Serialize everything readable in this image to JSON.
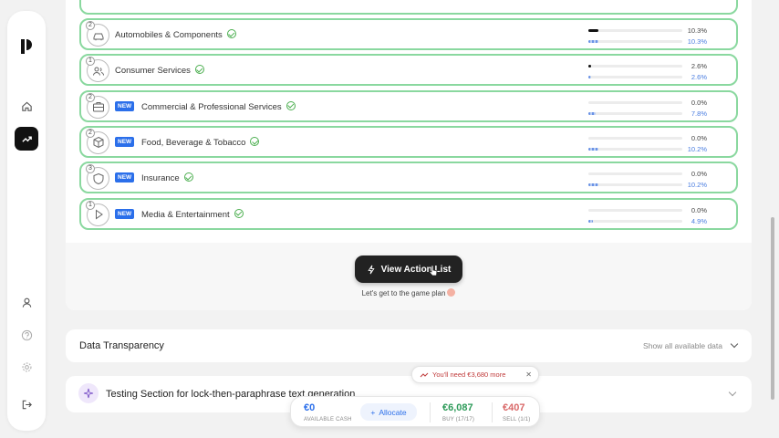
{
  "sidebar": {
    "items": [
      {
        "name": "home",
        "icon": "home-icon"
      },
      {
        "name": "trending",
        "icon": "trending-up-icon",
        "active": true
      },
      {
        "name": "profile",
        "icon": "user-icon"
      },
      {
        "name": "help",
        "icon": "help-icon"
      },
      {
        "name": "settings",
        "icon": "gear-icon"
      },
      {
        "name": "logout",
        "icon": "logout-icon"
      }
    ]
  },
  "sectors": [
    {
      "step": "2",
      "name": "Automobiles & Components",
      "is_new": false,
      "badge": "",
      "current": "10.3%",
      "target": "10.3%",
      "current_value": 0.103,
      "target_value": 0.103,
      "icon": "car-icon"
    },
    {
      "step": "1",
      "name": "Consumer Services",
      "is_new": false,
      "badge": "",
      "current": "2.6%",
      "target": "2.6%",
      "current_value": 0.026,
      "target_value": 0.026,
      "icon": "people-icon"
    },
    {
      "step": "2",
      "name": "Commercial & Professional Services",
      "is_new": true,
      "badge": "NEW",
      "current": "0.0%",
      "target": "7.8%",
      "current_value": 0.0,
      "target_value": 0.078,
      "icon": "briefcase-icon"
    },
    {
      "step": "2",
      "name": "Food, Beverage & Tobacco",
      "is_new": true,
      "badge": "NEW",
      "current": "0.0%",
      "target": "10.2%",
      "current_value": 0.0,
      "target_value": 0.102,
      "icon": "box-icon"
    },
    {
      "step": "3",
      "name": "Insurance",
      "is_new": true,
      "badge": "NEW",
      "current": "0.0%",
      "target": "10.2%",
      "current_value": 0.0,
      "target_value": 0.102,
      "icon": "shield-icon"
    },
    {
      "step": "1",
      "name": "Media & Entertainment",
      "is_new": true,
      "badge": "NEW",
      "current": "0.0%",
      "target": "4.9%",
      "current_value": 0.0,
      "target_value": 0.049,
      "icon": "play-icon"
    }
  ],
  "action": {
    "button_label": "View Action List",
    "caption": "Let's get to the game plan"
  },
  "data_transparency": {
    "title": "Data Transparency",
    "link": "Show all available data"
  },
  "testing_section": {
    "title": "Testing Section for lock-then-paraphrase text generation"
  },
  "need_tip": {
    "text": "You'll need €3,680 more"
  },
  "allocation_bar": {
    "cash_value": "€0",
    "cash_label": "AVAILABLE CASH",
    "allocate_label": "Allocate",
    "buy_value": "€6,087",
    "buy_label": "BUY (17/17)",
    "sell_value": "€407",
    "sell_label": "SELL (1/1)"
  },
  "colors": {
    "accent": "#2b6fea",
    "success": "#4caf50",
    "buy": "#2e9b5a",
    "sell": "#d96a6a"
  }
}
